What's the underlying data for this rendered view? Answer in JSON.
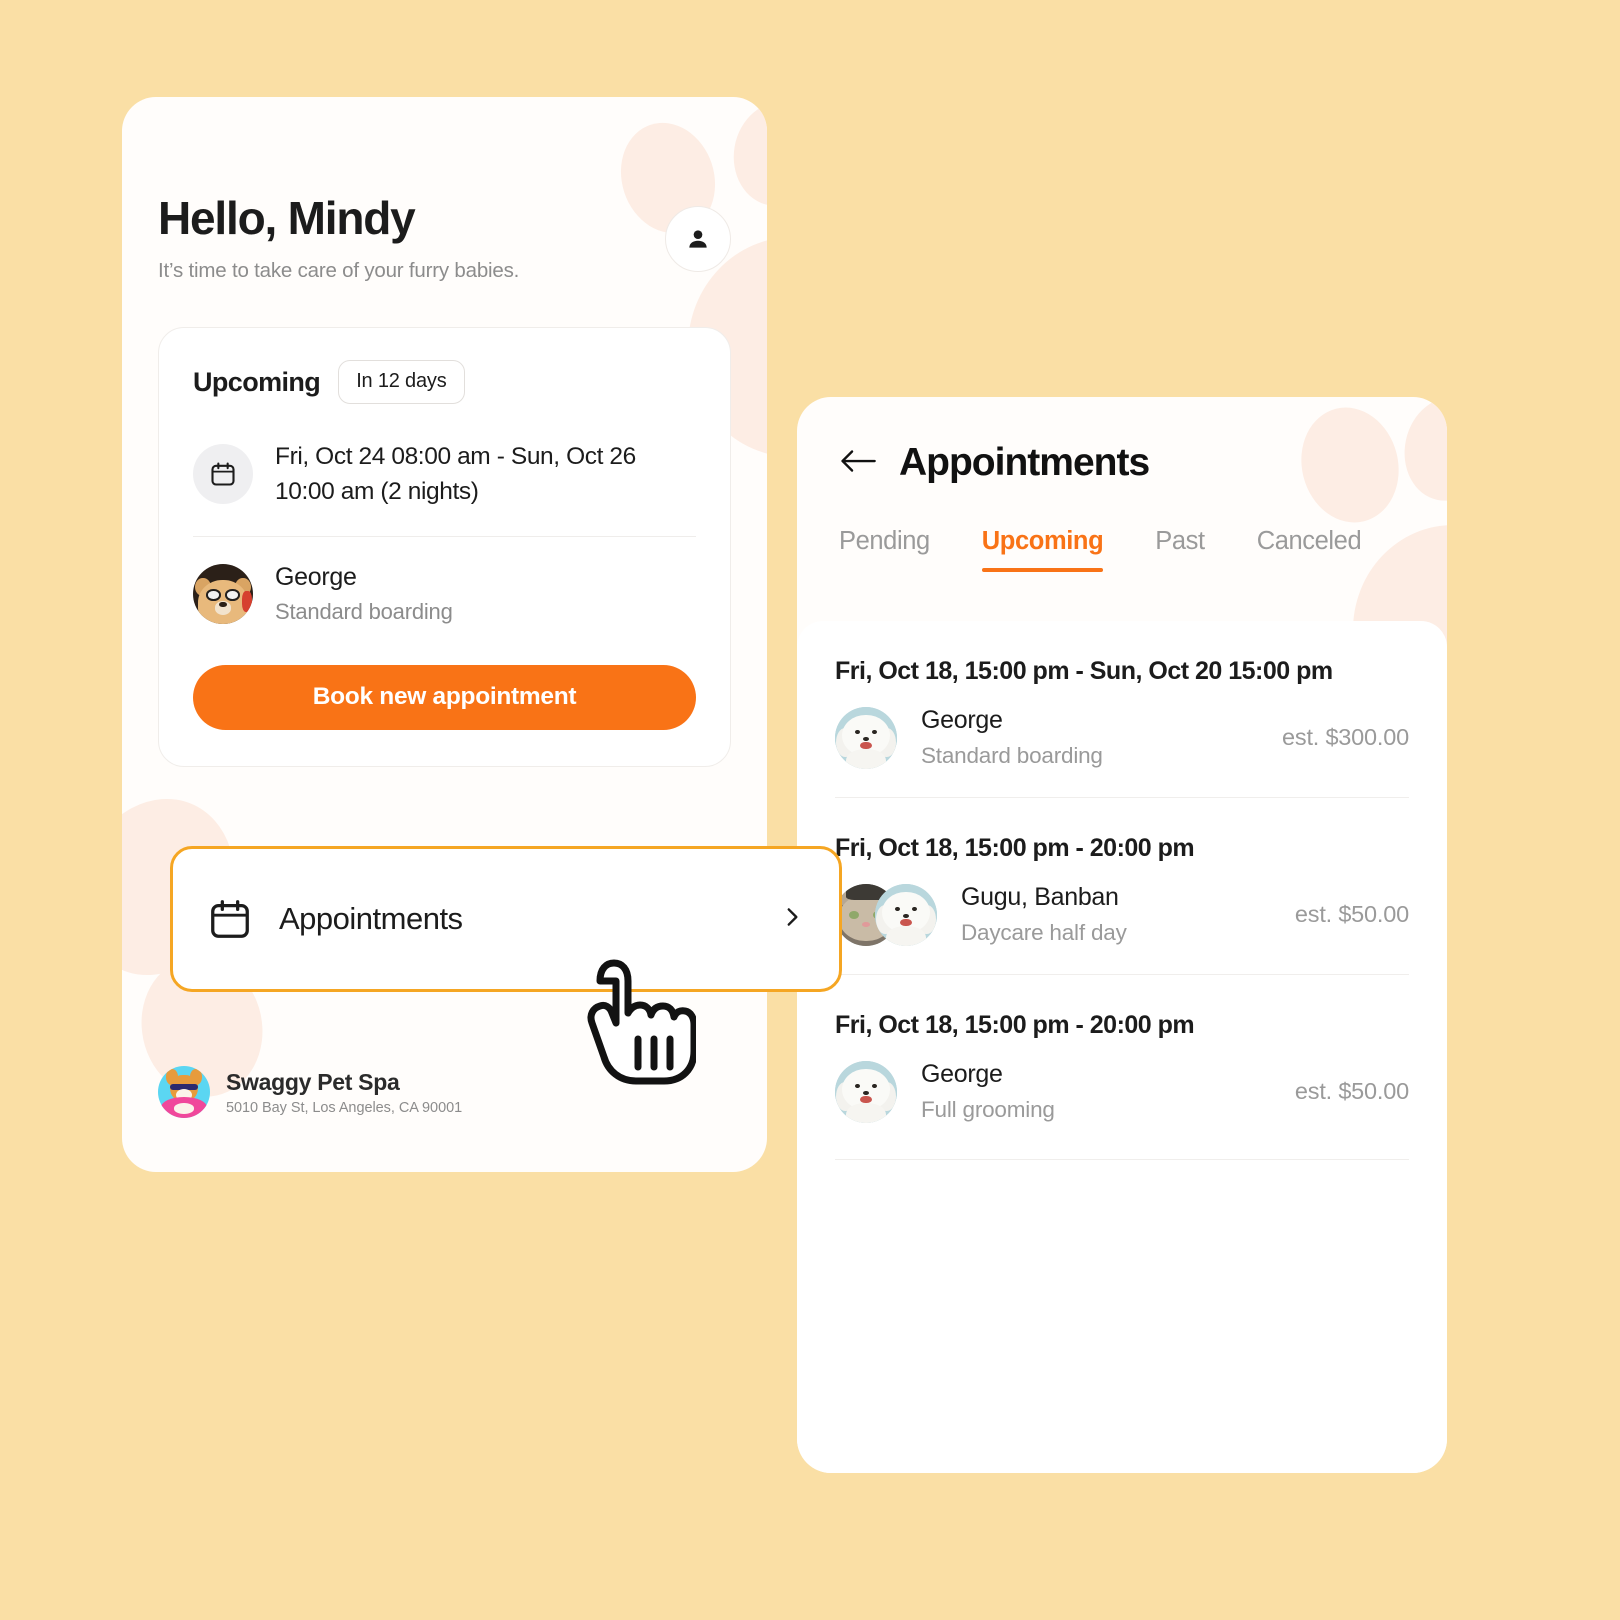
{
  "theme": {
    "page_background": "#FADFA5",
    "accent_orange": "#F97316",
    "highlight_border": "#F5A623",
    "card_background": "#FFFFFF"
  },
  "home": {
    "greeting": "Hello, Mindy",
    "subtitle": "It’s time to take care of your furry babies.",
    "profile_icon": "person-icon",
    "upcoming_card": {
      "title": "Upcoming",
      "badge": "In 12 days",
      "calendar_icon": "calendar-icon",
      "datetime": "Fri, Oct 24 08:00 am - Sun, Oct 26 10:00 am  (2 nights)",
      "pet_name": "George",
      "pet_service": "Standard boarding",
      "cta_label": "Book new appointment"
    },
    "nav_row": {
      "icon": "calendar-icon",
      "label": "Appointments",
      "chevron": "chevron-right-icon"
    },
    "footer": {
      "logo": "corgi-logo-icon",
      "business_name": "Swaggy Pet Spa",
      "address": "5010 Bay St, Los Angeles, CA 90001"
    }
  },
  "appointments": {
    "back_icon": "arrow-left-icon",
    "title": "Appointments",
    "tabs": [
      {
        "label": "Pending",
        "active": false
      },
      {
        "label": "Upcoming",
        "active": true
      },
      {
        "label": "Past",
        "active": false
      },
      {
        "label": "Canceled",
        "active": false
      }
    ],
    "items": [
      {
        "date": "Fri, Oct 18, 15:00 pm - Sun, Oct 20 15:00 pm",
        "pets": "George",
        "service": "Standard boarding",
        "price": "est. $300.00",
        "avatars": 1
      },
      {
        "date": "Fri, Oct 18, 15:00 pm - 20:00 pm",
        "pets": "Gugu, Banban",
        "service": "Daycare half day",
        "price": "est. $50.00",
        "avatars": 2
      },
      {
        "date": "Fri, Oct 18, 15:00 pm - 20:00 pm",
        "pets": "George",
        "service": "Full grooming",
        "price": "est. $50.00",
        "avatars": 1
      }
    ]
  },
  "cursor": {
    "type": "pointing-hand-cursor"
  }
}
